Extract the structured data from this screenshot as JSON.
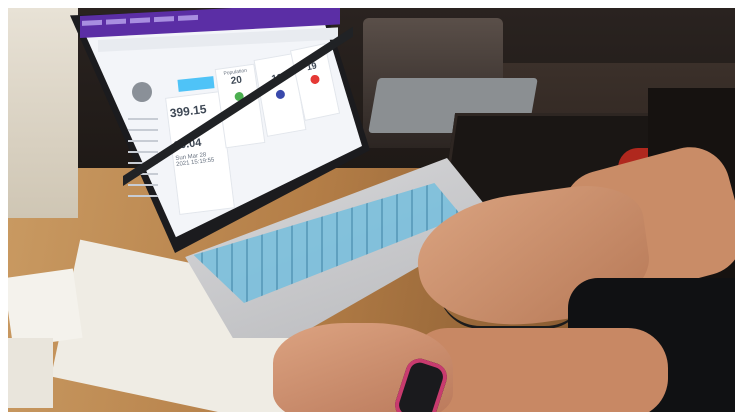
{
  "screen": {
    "value_main": "399.15",
    "value_second": "80.04",
    "date_text": "Sun Mar 28",
    "time_text": "2021 15:19:55",
    "label_population": "Population",
    "count_population": "20",
    "count_second": "19",
    "count_third": "19"
  },
  "colors": {
    "browser_bar": "#5b2ea5",
    "keyboard_cover": "#7fc0dc",
    "dot_green": "#4caf50",
    "dot_blue": "#3949ab",
    "dot_red": "#e53935",
    "button_cyan": "#4fc3f7",
    "wrist_band": "#c83b6e"
  }
}
